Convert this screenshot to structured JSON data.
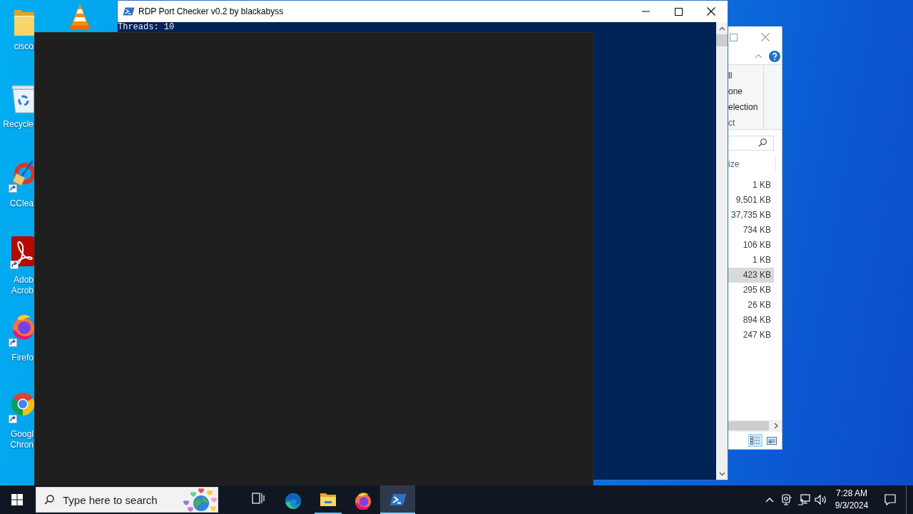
{
  "desktop": {
    "icons": [
      {
        "kind": "folder",
        "label_lines": [
          "cisco"
        ],
        "shortcut": false
      },
      {
        "kind": "vlc",
        "shortcut": false
      },
      {
        "kind": "recycle_bin",
        "label_lines": [
          "Recycle"
        ],
        "shortcut": false
      },
      {
        "kind": "ccleaner",
        "label_lines": [
          "CClea"
        ],
        "shortcut": true
      },
      {
        "kind": "acrobat",
        "label_lines": [
          "Adob",
          "Acrob"
        ],
        "shortcut": true
      },
      {
        "kind": "firefox",
        "label_lines": [
          "Firefo"
        ],
        "shortcut": true
      },
      {
        "kind": "chrome",
        "label_lines": [
          "Googl",
          "Chron"
        ],
        "shortcut": true
      }
    ]
  },
  "console_window": {
    "title": "RDP Port Checker v0.2 by blackabyss",
    "lines": [
      "Threads: 10"
    ]
  },
  "explorer_window": {
    "ribbon_commands": [
      "ll",
      "one",
      "election"
    ],
    "ribbon_group_label": "ct",
    "column_header": "ize",
    "rows": [
      {
        "value": "1 KB",
        "selected": false
      },
      {
        "value": "9,501 KB",
        "selected": false
      },
      {
        "value": "37,735 KB",
        "selected": false
      },
      {
        "value": "734 KB",
        "selected": false
      },
      {
        "value": "106 KB",
        "selected": false
      },
      {
        "value": "1 KB",
        "selected": false
      },
      {
        "value": "423 KB",
        "selected": true
      },
      {
        "value": "295 KB",
        "selected": false
      },
      {
        "value": "26 KB",
        "selected": false
      },
      {
        "value": "894 KB",
        "selected": false
      },
      {
        "value": "247 KB",
        "selected": false
      }
    ],
    "views": [
      {
        "kind": "details",
        "selected": true
      },
      {
        "kind": "large_icons",
        "selected": false
      }
    ]
  },
  "taskbar": {
    "search": {
      "placeholder": "Type here to search"
    },
    "apps": [
      {
        "kind": "task_view",
        "running": false,
        "selected": false
      },
      {
        "kind": "edge",
        "running": false,
        "selected": false
      },
      {
        "kind": "file_explorer",
        "running": true,
        "selected": false
      },
      {
        "kind": "firefox",
        "running": false,
        "selected": false
      },
      {
        "kind": "powershell",
        "running": true,
        "selected": true
      }
    ],
    "clock": {
      "time": "7:28 AM",
      "date": "9/3/2024"
    }
  }
}
